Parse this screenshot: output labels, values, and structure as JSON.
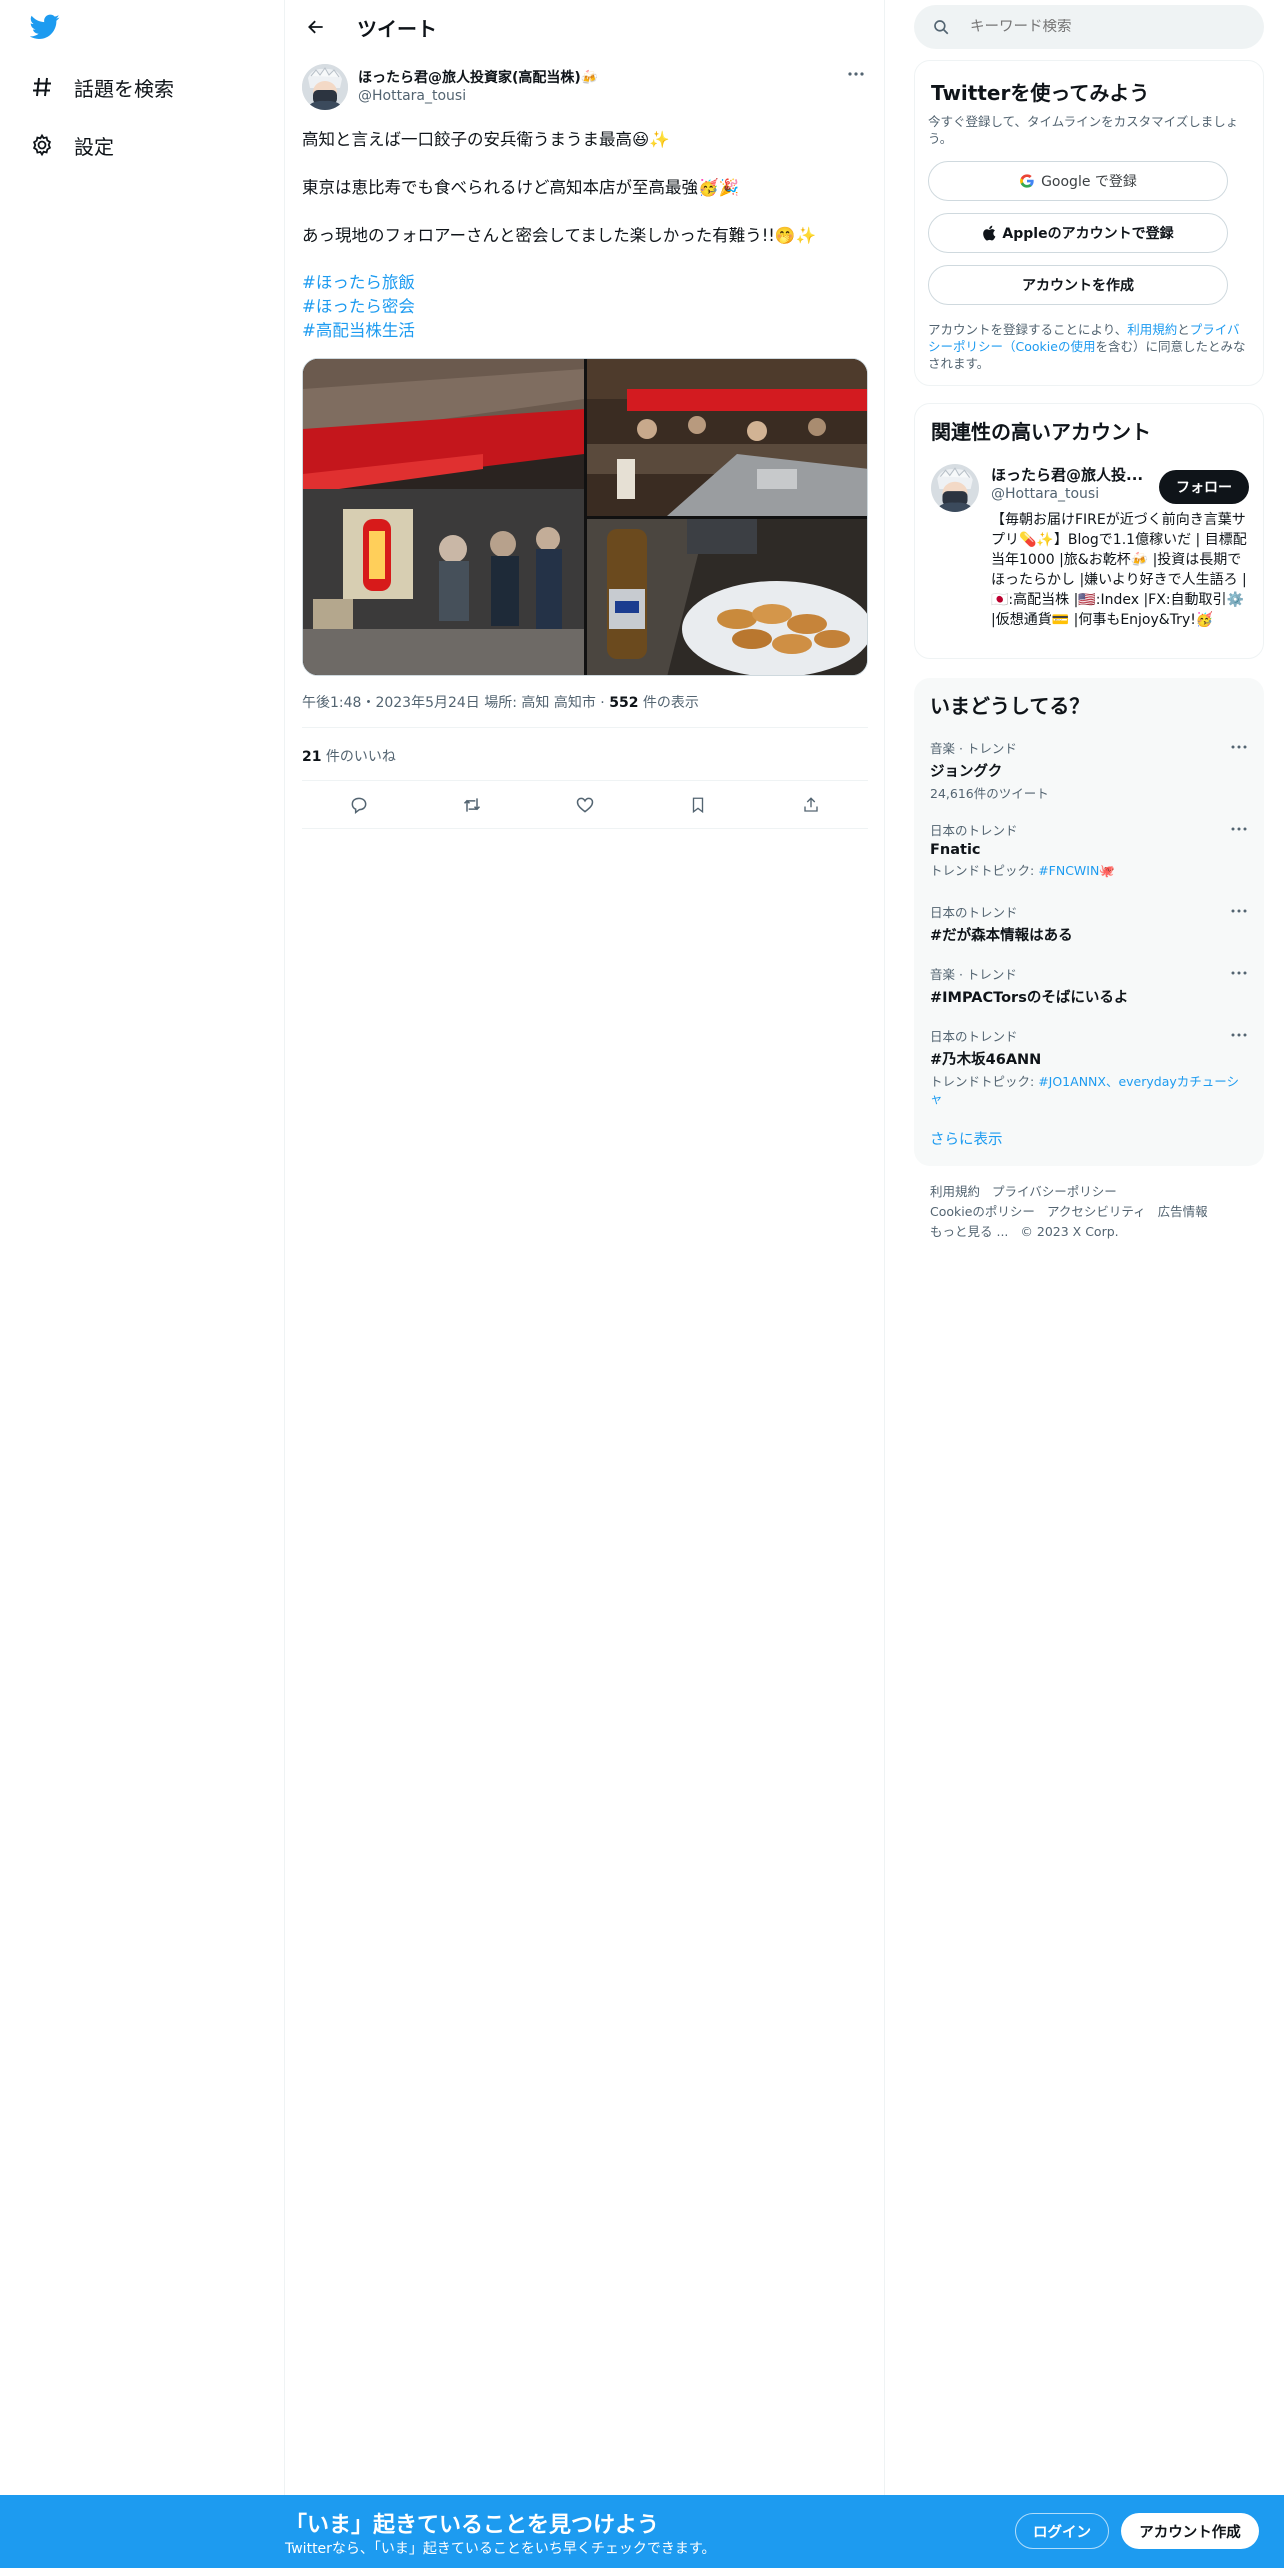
{
  "colors": {
    "accent": "#1d9bf0",
    "text": "#0f1419",
    "muted": "#536471",
    "banner": "#1d9bf0"
  },
  "nav": {
    "logo_icon": "twitter-bird-icon",
    "items": [
      {
        "icon": "hashtag-icon",
        "label": "話題を検索"
      },
      {
        "icon": "gear-icon",
        "label": "設定"
      }
    ]
  },
  "header": {
    "back_icon": "arrow-left-icon",
    "title": "ツイート"
  },
  "tweet": {
    "author_name": "ほったら君@旅人投資家(高配当株)🍻",
    "author_handle": "@Hottara_tousi",
    "lines": [
      "高知と言えば一口餃子の安兵衛うまうま最高😆✨",
      "東京は恵比寿でも食べられるけど高知本店が至高最強🥳🎉",
      "あっ現地のフォロアーさんと密会してました楽しかった有難う!!🤭✨"
    ],
    "hashtags": [
      "#ほったら旅飯",
      "#ほったら密会",
      "#高配当株生活"
    ],
    "meta_prefix": "午後1:48・2023年5月24日 場所: 高知 高知市 · ",
    "views_count": "552",
    "views_label": " 件の表示",
    "likes_count": "21",
    "likes_label": " 件のいいね",
    "actions": [
      "reply-icon",
      "retweet-icon",
      "like-icon",
      "bookmark-icon",
      "share-icon"
    ]
  },
  "search": {
    "placeholder": "キーワード検索"
  },
  "signup_card": {
    "title": "Twitterを使ってみよう",
    "subtitle": "今すぐ登録して、タイムラインをカスタマイズしましょう。",
    "google_label": "Google で登録",
    "apple_label": "Appleのアカウントで登録",
    "create_label": "アカウントを作成",
    "terms_prefix": "アカウントを登録することにより、",
    "terms_link": "利用規約",
    "terms_mid": "と",
    "privacy_link": "プライバシーポリシー",
    "cookie_link": "（Cookieの使用",
    "terms_suffix": "を含む）に同意したとみなされます。"
  },
  "related_card": {
    "title": "関連性の高いアカウント",
    "name": "ほったら君@旅人投...",
    "handle": "@Hottara_tousi",
    "follow_label": "フォロー",
    "bio": "【毎朝お届けFIREが近づく前向き言葉サプリ💊✨】Blogで1.1億稼いだ | 目標配当年1000 |旅&お乾杯🍻 |投資は長期でほったらかし |嫌いより好きで人生語ろ | 🇯🇵:高配当株 |🇺🇸:Index |FX:自動取引⚙️ |仮想通貨💳 |何事もEnjoy&Try!🥳"
  },
  "trends_card": {
    "title": "いまどうしてる？",
    "items": [
      {
        "category": "音楽 · トレンド",
        "name": "ジョングク",
        "sub": "24,616件のツイート",
        "sub_link": ""
      },
      {
        "category": "日本のトレンド",
        "name": "Fnatic",
        "sub": "トレンドトピック: ",
        "sub_link": "#FNCWIN🐙"
      },
      {
        "category": "日本のトレンド",
        "name": "#だが森本情報はある",
        "sub": "",
        "sub_link": ""
      },
      {
        "category": "音楽 · トレンド",
        "name": "#IMPACTorsのそばにいるよ",
        "sub": "",
        "sub_link": ""
      },
      {
        "category": "日本のトレンド",
        "name": "#乃木坂46ANN",
        "sub": "トレンドトピック: ",
        "sub_link": "#JO1ANNX、everydayカチューシャ"
      }
    ],
    "show_more": "さらに表示"
  },
  "footer": {
    "links": [
      "利用規約",
      "プライバシーポリシー",
      "Cookieのポリシー",
      "アクセシビリティ",
      "広告情報",
      "もっと見る ...",
      "© 2023 X Corp."
    ]
  },
  "banner": {
    "title": "「いま」起きていることを見つけよう",
    "subtitle": "Twitterなら、「いま」起きていることをいち早くチェックできます。",
    "login_label": "ログイン",
    "signup_label": "アカウント作成"
  }
}
